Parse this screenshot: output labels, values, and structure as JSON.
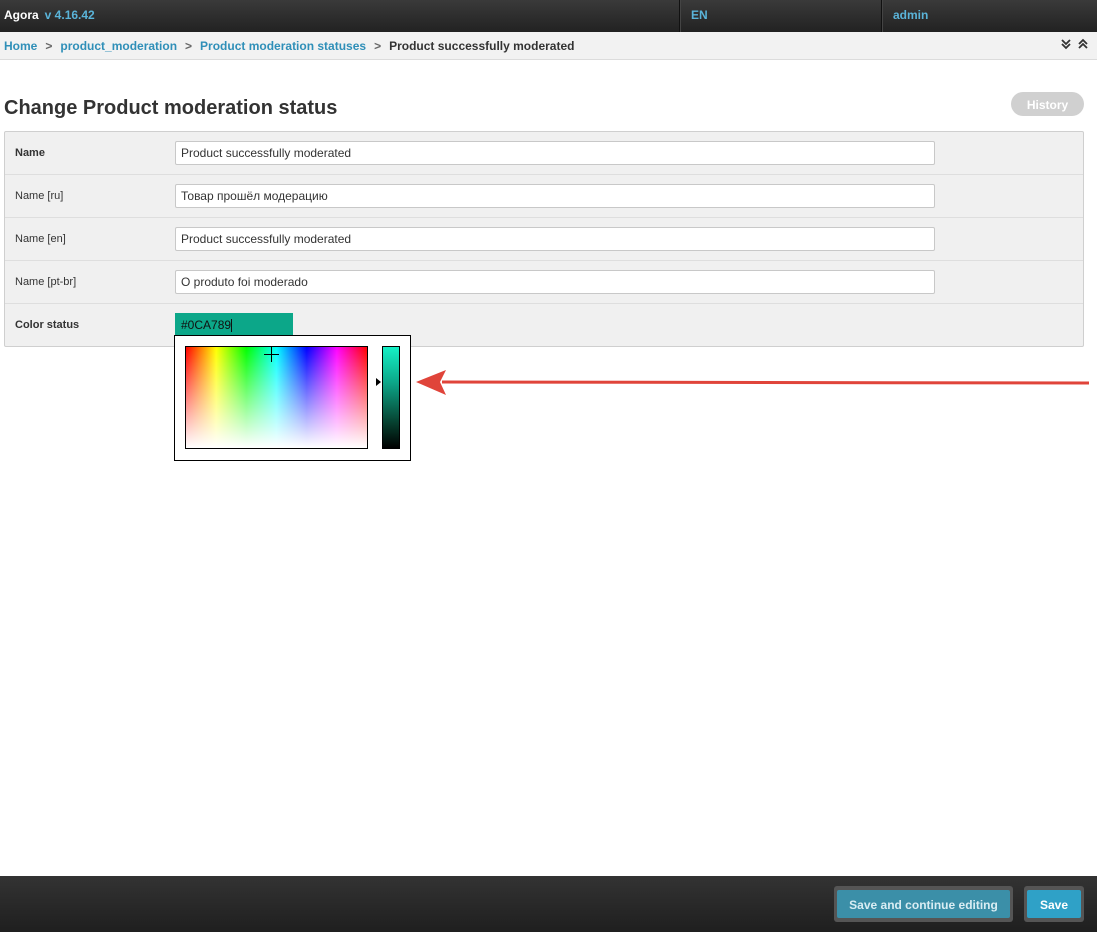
{
  "header": {
    "app_name": "Agora",
    "version": "v 4.16.42",
    "language": "EN",
    "user": "admin"
  },
  "breadcrumb": {
    "items": [
      "Home",
      "product_moderation",
      "Product moderation statuses"
    ],
    "current": "Product successfully moderated",
    "separator": ">"
  },
  "page": {
    "title": "Change Product moderation status",
    "history_label": "History"
  },
  "form": {
    "fields": [
      {
        "label": "Name",
        "value": "Product successfully moderated"
      },
      {
        "label": "Name [ru]",
        "value": "Товар прошёл модерацию"
      },
      {
        "label": "Name [en]",
        "value": "Product successfully moderated"
      },
      {
        "label": "Name [pt-br]",
        "value": "O produto foi moderado"
      }
    ],
    "color": {
      "label": "Color status",
      "value": "#0CA789"
    }
  },
  "footer": {
    "save_continue_label": "Save and continue editing",
    "save_label": "Save"
  },
  "colors": {
    "accent": "#2f8fb8",
    "selected_color": "#0CA789",
    "annotation_arrow": "#e0443a"
  }
}
